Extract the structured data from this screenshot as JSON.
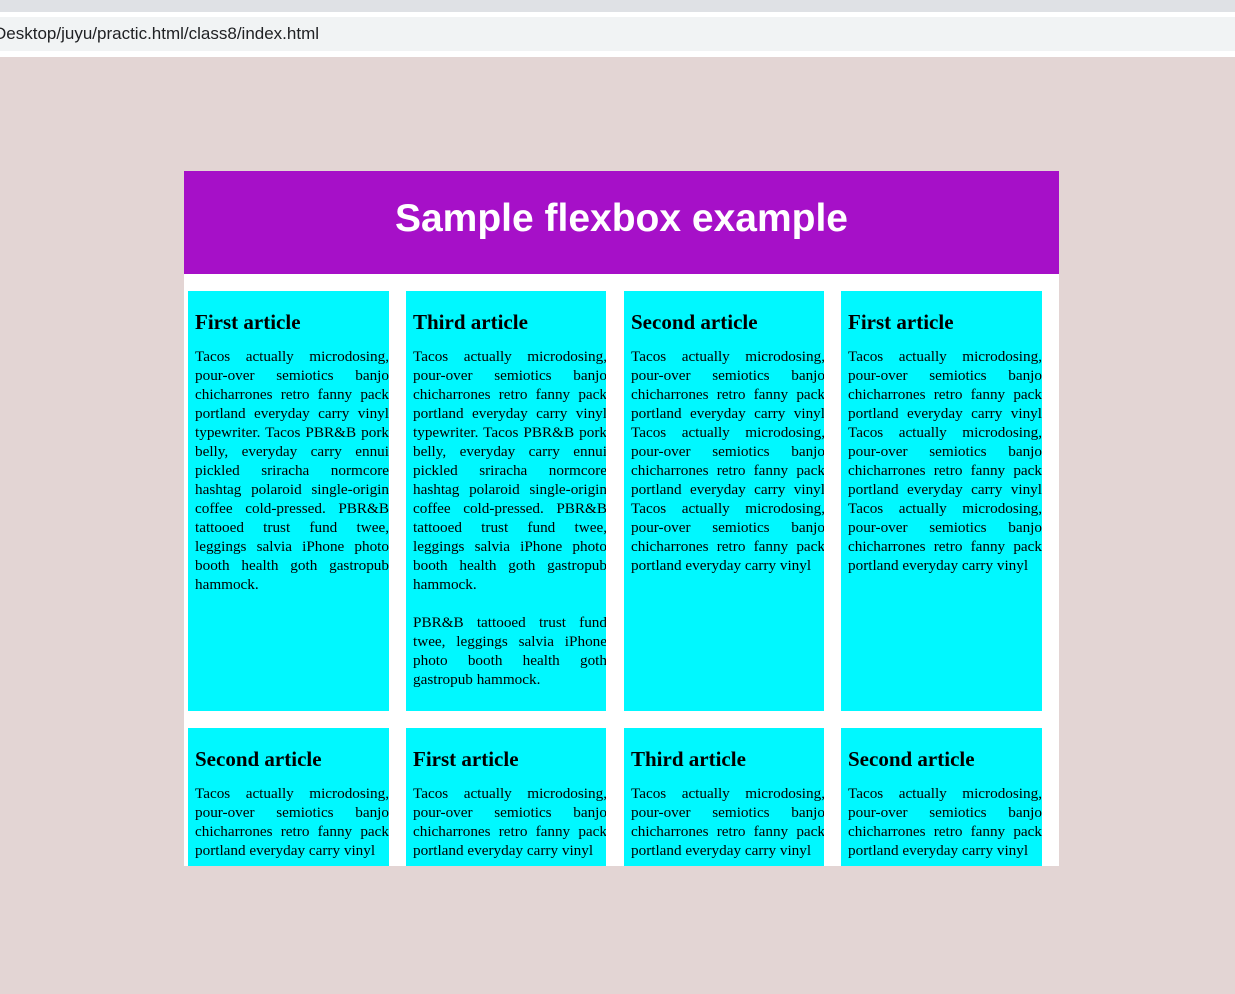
{
  "browser": {
    "address": "Desktop/juyu/practic.html/class8/index.html"
  },
  "page": {
    "title": "Sample flexbox example"
  },
  "articles": [
    {
      "heading": "First article",
      "paragraphs": [
        "Tacos actually microdosing, pour-over semiotics banjo chicharrones retro fanny pack portland everyday carry vinyl typewriter. Tacos PBR&B pork belly, everyday carry ennui pickled sriracha normcore hashtag polaroid single-origin coffee cold-pressed. PBR&B tattooed trust fund twee, leggings salvia iPhone photo booth health goth gastropub hammock."
      ]
    },
    {
      "heading": "Third article",
      "paragraphs": [
        "Tacos actually microdosing, pour-over semiotics banjo chicharrones retro fanny pack portland everyday carry vinyl typewriter. Tacos PBR&B pork belly, everyday carry ennui pickled sriracha normcore hashtag polaroid single-origin coffee cold-pressed. PBR&B tattooed trust fund twee, leggings salvia iPhone photo booth health goth gastropub hammock.",
        "PBR&B tattooed trust fund twee, leggings salvia iPhone photo booth health goth gastropub hammock."
      ]
    },
    {
      "heading": "Second article",
      "paragraphs": [
        "Tacos actually microdosing, pour-over semiotics banjo chicharrones retro fanny pack portland everyday carry vinyl Tacos actually microdosing, pour-over semiotics banjo chicharrones retro fanny pack portland everyday carry vinyl Tacos actually microdosing, pour-over semiotics banjo chicharrones retro fanny pack portland everyday carry vinyl"
      ]
    },
    {
      "heading": "First article",
      "paragraphs": [
        "Tacos actually microdosing, pour-over semiotics banjo chicharrones retro fanny pack portland everyday carry vinyl Tacos actually microdosing, pour-over semiotics banjo chicharrones retro fanny pack portland everyday carry vinyl Tacos actually microdosing, pour-over semiotics banjo chicharrones retro fanny pack portland everyday carry vinyl"
      ]
    },
    {
      "heading": "Second article",
      "paragraphs": [
        "Tacos actually microdosing, pour-over semiotics banjo chicharrones retro fanny pack portland everyday carry vinyl"
      ]
    },
    {
      "heading": "First article",
      "paragraphs": [
        "Tacos actually microdosing, pour-over semiotics banjo chicharrones retro fanny pack portland everyday carry vinyl"
      ]
    },
    {
      "heading": "Third article",
      "paragraphs": [
        "Tacos actually microdosing, pour-over semiotics banjo chicharrones retro fanny pack portland everyday carry vinyl"
      ]
    },
    {
      "heading": "Second article",
      "paragraphs": [
        "Tacos actually microdosing, pour-over semiotics banjo chicharrones retro fanny pack portland everyday carry vinyl"
      ]
    }
  ]
}
